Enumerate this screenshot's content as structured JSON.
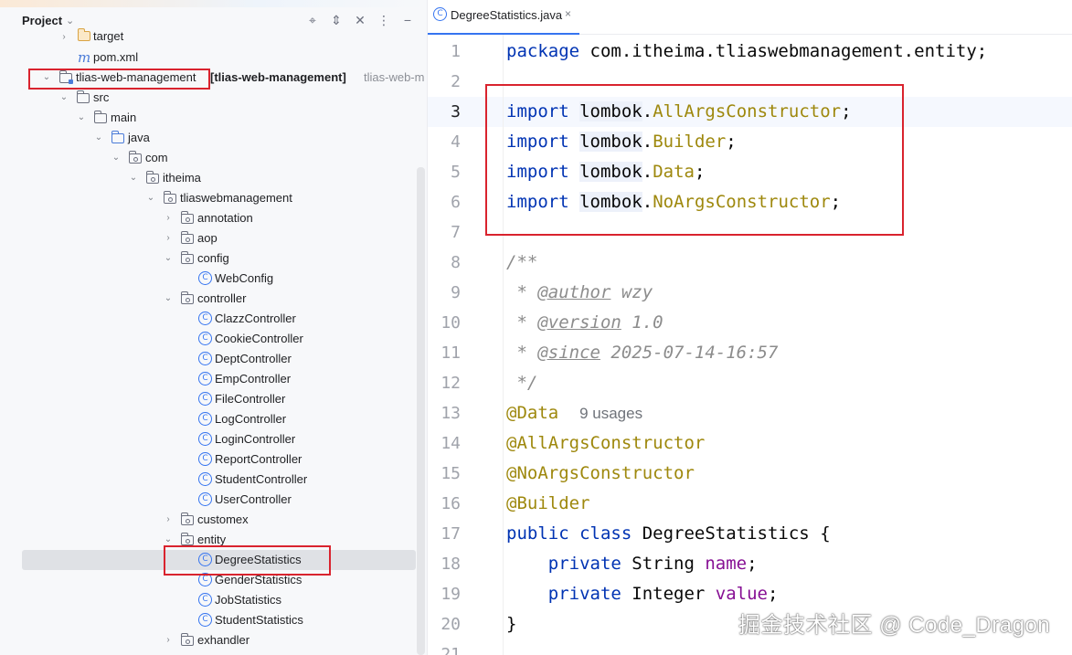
{
  "project_panel": {
    "title": "Project",
    "title_chevron": "⌄",
    "header_icons": [
      "crosshair-icon",
      "expand-collapse-icon",
      "close-all-icon",
      "more-icon",
      "minimize-icon"
    ],
    "tree": [
      {
        "label": "target",
        "icon": "folder-orange",
        "chevron": "›"
      },
      {
        "label": "pom.xml",
        "icon": "maven-icon",
        "chevron": ""
      },
      {
        "label": "tlias-web-management",
        "suffix_bold": "[tlias-web-management]",
        "suffix_gray": "tlias-web-m",
        "icon": "module-folder",
        "chevron": "⌄"
      },
      {
        "label": "src",
        "icon": "folder",
        "chevron": "⌄"
      },
      {
        "label": "main",
        "icon": "folder",
        "chevron": "⌄"
      },
      {
        "label": "java",
        "icon": "folder-blue",
        "chevron": "⌄"
      },
      {
        "label": "com",
        "icon": "package",
        "chevron": "⌄"
      },
      {
        "label": "itheima",
        "icon": "package",
        "chevron": "⌄"
      },
      {
        "label": "tliaswebmanagement",
        "icon": "package",
        "chevron": "⌄"
      },
      {
        "label": "annotation",
        "icon": "package",
        "chevron": "›"
      },
      {
        "label": "aop",
        "icon": "package",
        "chevron": "›"
      },
      {
        "label": "config",
        "icon": "package",
        "chevron": "⌄"
      },
      {
        "label": "WebConfig",
        "icon": "class",
        "chevron": ""
      },
      {
        "label": "controller",
        "icon": "package",
        "chevron": "⌄"
      },
      {
        "label": "ClazzController",
        "icon": "class",
        "chevron": ""
      },
      {
        "label": "CookieController",
        "icon": "class",
        "chevron": ""
      },
      {
        "label": "DeptController",
        "icon": "class",
        "chevron": ""
      },
      {
        "label": "EmpController",
        "icon": "class",
        "chevron": ""
      },
      {
        "label": "FileController",
        "icon": "class",
        "chevron": ""
      },
      {
        "label": "LogController",
        "icon": "class",
        "chevron": ""
      },
      {
        "label": "LoginController",
        "icon": "class",
        "chevron": ""
      },
      {
        "label": "ReportController",
        "icon": "class",
        "chevron": ""
      },
      {
        "label": "StudentController",
        "icon": "class",
        "chevron": ""
      },
      {
        "label": "UserController",
        "icon": "class",
        "chevron": ""
      },
      {
        "label": "customex",
        "icon": "package",
        "chevron": "›"
      },
      {
        "label": "entity",
        "icon": "package",
        "chevron": "⌄"
      },
      {
        "label": "DegreeStatistics",
        "icon": "class",
        "chevron": "",
        "selected": true
      },
      {
        "label": "GenderStatistics",
        "icon": "class",
        "chevron": ""
      },
      {
        "label": "JobStatistics",
        "icon": "class",
        "chevron": ""
      },
      {
        "label": "StudentStatistics",
        "icon": "class",
        "chevron": ""
      },
      {
        "label": "exhandler",
        "icon": "package",
        "chevron": "›"
      }
    ]
  },
  "editor": {
    "tab": {
      "label": "DegreeStatistics.java",
      "icon_letter": "C",
      "close": "×"
    },
    "current_line": 3,
    "line_numbers": [
      "1",
      "2",
      "3",
      "4",
      "5",
      "6",
      "7",
      "8",
      "9",
      "10",
      "11",
      "12",
      "13",
      "14",
      "15",
      "16",
      "17",
      "18",
      "19",
      "20",
      "21"
    ],
    "code": {
      "l1": {
        "kw": "package",
        "rest": " com.itheima.tliaswebmanagement.entity;"
      },
      "l3": {
        "kw": "import",
        "pkg": "lombok",
        "dot": ".",
        "ty": "AllArgsConstructor",
        "end": ";"
      },
      "l4": {
        "kw": "import",
        "pkg": "lombok",
        "dot": ".",
        "ty": "Builder",
        "end": ";"
      },
      "l5": {
        "kw": "import",
        "pkg": "lombok",
        "dot": ".",
        "ty": "Data",
        "end": ";"
      },
      "l6": {
        "kw": "import",
        "pkg": "lombok",
        "dot": ".",
        "ty": "NoArgsConstructor",
        "end": ";"
      },
      "l8": "/**",
      "l9": {
        "star": " * ",
        "tag": "@author",
        "val": " wzy"
      },
      "l10": {
        "star": " * ",
        "tag": "@version",
        "val": " 1.0"
      },
      "l11": {
        "star": " * ",
        "tag": "@since",
        "val": " 2025-07-14-16:57"
      },
      "l12": " */",
      "l13": {
        "ann": "@Data",
        "usage": "9 usages"
      },
      "l14": "@AllArgsConstructor",
      "l15": "@NoArgsConstructor",
      "l16": "@Builder",
      "l17": {
        "kw": "public class",
        "name": " DegreeStatistics ",
        "brace": "{"
      },
      "l18": {
        "kw": "private",
        "type": " String ",
        "field": "name",
        "end": ";"
      },
      "l19": {
        "kw": "private",
        "type": " Integer ",
        "field": "value",
        "end": ";"
      },
      "l20": "}"
    }
  },
  "watermark": "掘金技术社区 @ Code_Dragon",
  "colors": {
    "highlight_box": "#d9232e",
    "keyword": "#0033b3",
    "annotation": "#9e880d",
    "field": "#871094",
    "selection": "#dfe1e5"
  }
}
